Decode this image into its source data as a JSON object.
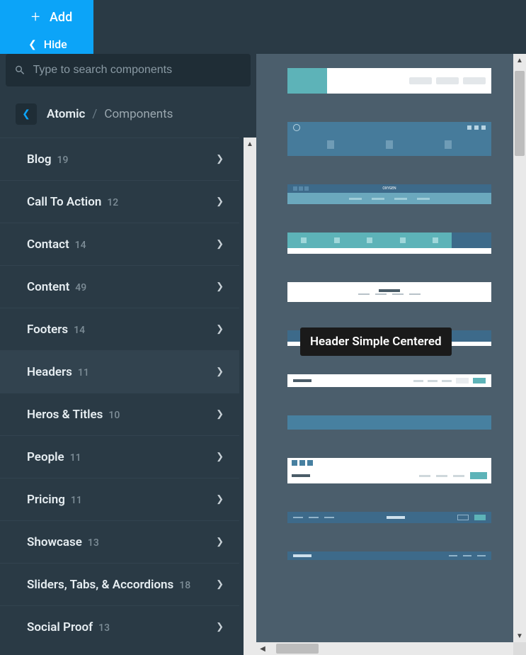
{
  "topbar": {
    "add_label": "Add",
    "hide_label": "Hide"
  },
  "search": {
    "placeholder": "Type to search components"
  },
  "breadcrumb": {
    "root": "Atomic",
    "current": "Components"
  },
  "categories": [
    {
      "label": "Blog",
      "count": "19",
      "active": false
    },
    {
      "label": "Call To Action",
      "count": "12",
      "active": false
    },
    {
      "label": "Contact",
      "count": "14",
      "active": false
    },
    {
      "label": "Content",
      "count": "49",
      "active": false
    },
    {
      "label": "Footers",
      "count": "14",
      "active": false
    },
    {
      "label": "Headers",
      "count": "11",
      "active": true
    },
    {
      "label": "Heros & Titles",
      "count": "10",
      "active": false
    },
    {
      "label": "People",
      "count": "11",
      "active": false
    },
    {
      "label": "Pricing",
      "count": "11",
      "active": false
    },
    {
      "label": "Showcase",
      "count": "13",
      "active": false
    },
    {
      "label": "Sliders, Tabs, & Accordions",
      "count": "18",
      "active": false
    },
    {
      "label": "Social Proof",
      "count": "13",
      "active": false
    }
  ],
  "gallery": {
    "tooltip": "Header Simple Centered",
    "brand_text": "OXYGEN"
  }
}
